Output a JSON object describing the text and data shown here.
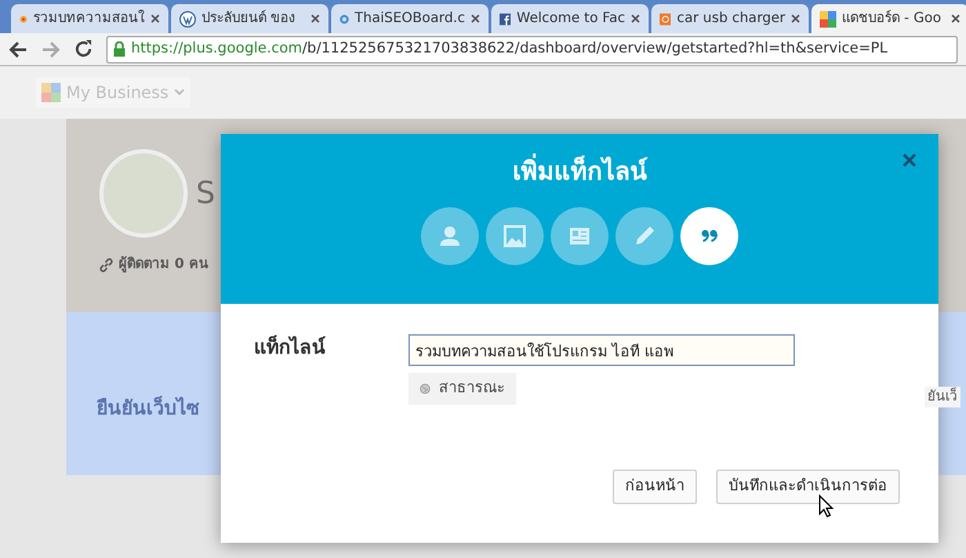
{
  "browser": {
    "tabs": [
      {
        "title": "รวมบทความสอนใ",
        "selected": false
      },
      {
        "title": "ประลับยนต์ ของ",
        "selected": false
      },
      {
        "title": "ThaiSEOBoard.c",
        "selected": false
      },
      {
        "title": "Welcome to Fac",
        "selected": false
      },
      {
        "title": "car usb charger",
        "selected": false
      },
      {
        "title": "แดชบอร์ด - Goo",
        "selected": true
      }
    ],
    "url": {
      "host": "https://plus.google.com",
      "path": "/b/112525675321703838622/dashboard/overview/getstarted?hl=th&service=PL"
    }
  },
  "page": {
    "app_menu": "My Business",
    "profile": {
      "name": "S",
      "followers": "ผู้ติดตาม 0 คน"
    },
    "verify_heading": "ยืนยันเว็บไซ",
    "right_text": "ยันเว็"
  },
  "dialog": {
    "title": "เพิ่มแท็กไลน์",
    "steps": [
      {
        "kind": "person",
        "selected": false
      },
      {
        "kind": "image",
        "selected": false
      },
      {
        "kind": "card",
        "selected": false
      },
      {
        "kind": "pencil",
        "selected": false
      },
      {
        "kind": "quote",
        "selected": true
      }
    ],
    "field_label": "แท็กไลน์",
    "field_value": "รวมบทความสอนใช้โปรแกรม ไอที แอพ",
    "visibility": "สาธารณะ",
    "buttons": [
      "ก่อนหน้า",
      "บันทึกและดำเนินการต่อ"
    ]
  }
}
